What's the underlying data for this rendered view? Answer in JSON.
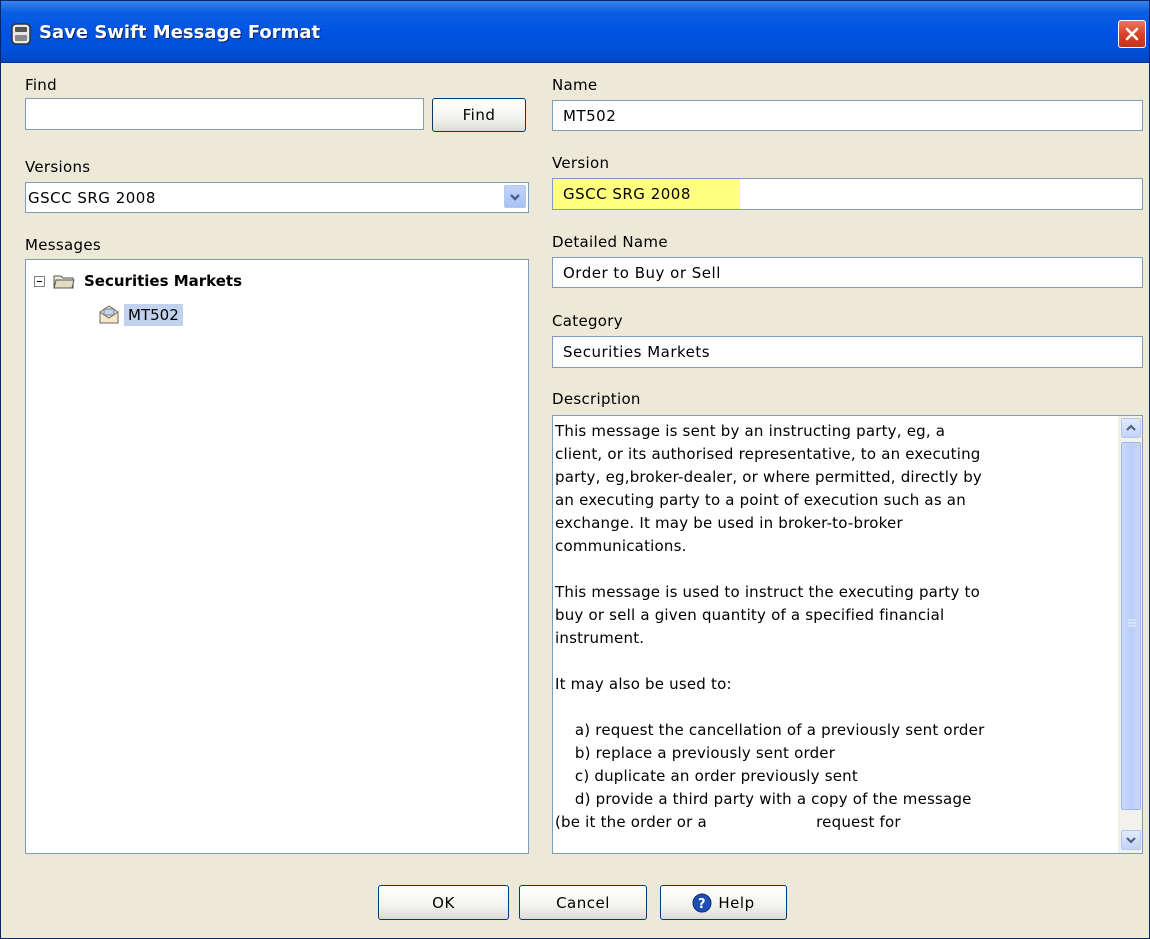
{
  "window": {
    "title": "Save Swift Message Format"
  },
  "find": {
    "label": "Find",
    "value": "",
    "button_label": "Find"
  },
  "versions": {
    "label": "Versions",
    "selected": "GSCC SRG 2008"
  },
  "messages": {
    "label": "Messages",
    "tree": {
      "folder_label": "Securities Markets",
      "items": [
        "MT502"
      ]
    }
  },
  "details": {
    "name_label": "Name",
    "name_value": "MT502",
    "version_label": "Version",
    "version_value": "GSCC SRG 2008",
    "version_highlight": "#FFFF80",
    "detailed_name_label": "Detailed Name",
    "detailed_name_value": "Order to Buy or Sell",
    "category_label": "Category",
    "category_value": "Securities Markets",
    "description_label": "Description",
    "description_text": "This message is sent by an instructing party, eg, a\nclient, or its authorised representative, to an executing\nparty, eg,broker-dealer, or where permitted, directly by\nan executing party to a point of execution such as an\nexchange. It may be used in broker-to-broker\ncommunications.\n\nThis message is used to instruct the executing party to\nbuy or sell a given quantity of a specified financial\ninstrument.\n\nIt may also be used to:\n\n    a) request the cancellation of a previously sent order\n    b) replace a previously sent order\n    c) duplicate an order previously sent\n    d) provide a third party with a copy of the message\n(be it the order or a                      request for"
  },
  "footer": {
    "ok_label": "OK",
    "cancel_label": "Cancel",
    "help_label": "Help"
  },
  "colors": {
    "titlebar": "#0054E3",
    "selection": "#C1D2EE",
    "dialog_bg": "#ECE9D8"
  }
}
